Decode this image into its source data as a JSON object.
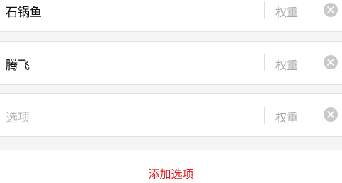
{
  "options": [
    {
      "value": "石锅鱼",
      "placeholder": "选项",
      "weight_label": "权重"
    },
    {
      "value": "腾飞",
      "placeholder": "选项",
      "weight_label": "权重"
    },
    {
      "value": "",
      "placeholder": "选项",
      "weight_label": "权重"
    }
  ],
  "add_option_label": "添加选项",
  "colors": {
    "accent": "#e02020",
    "clear_icon_bg": "#c9c9c9",
    "placeholder": "#b5b5b5"
  },
  "icons": {
    "clear": "close-circle-icon"
  }
}
